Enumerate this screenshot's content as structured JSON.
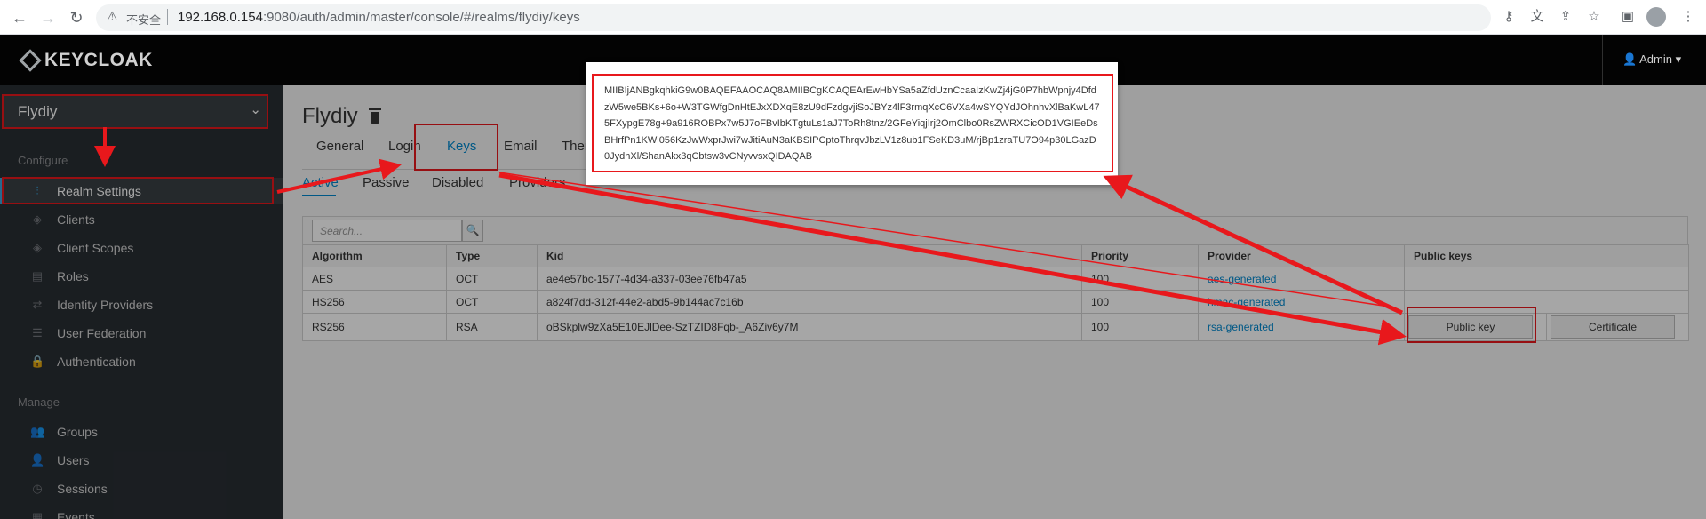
{
  "browser": {
    "insecure_label": "不安全",
    "url_host": "192.168.0.154",
    "url_path": ":9080/auth/admin/master/console/#/realms/flydiy/keys"
  },
  "header": {
    "logo_text": "KEYCLOAK",
    "user_label": "Admin"
  },
  "sidebar": {
    "realm": "Flydiy",
    "configure_label": "Configure",
    "configure_items": [
      {
        "label": "Realm Settings",
        "icon": "sliders-icon"
      },
      {
        "label": "Clients",
        "icon": "cube-icon"
      },
      {
        "label": "Client Scopes",
        "icon": "cubes-icon"
      },
      {
        "label": "Roles",
        "icon": "roles-icon"
      },
      {
        "label": "Identity Providers",
        "icon": "exchange-icon"
      },
      {
        "label": "User Federation",
        "icon": "database-icon"
      },
      {
        "label": "Authentication",
        "icon": "lock-icon"
      }
    ],
    "manage_label": "Manage",
    "manage_items": [
      {
        "label": "Groups",
        "icon": "users-icon"
      },
      {
        "label": "Users",
        "icon": "user-icon"
      },
      {
        "label": "Sessions",
        "icon": "clock-icon"
      },
      {
        "label": "Events",
        "icon": "calendar-icon"
      }
    ]
  },
  "main": {
    "title": "Flydiy",
    "tabs": [
      "General",
      "Login",
      "Keys",
      "Email",
      "Them"
    ],
    "subtabs": [
      "Active",
      "Passive",
      "Disabled",
      "Providers"
    ],
    "search_placeholder": "Search...",
    "table": {
      "headers": [
        "Algorithm",
        "Type",
        "Kid",
        "Priority",
        "Provider",
        "Public keys"
      ],
      "rows": [
        {
          "algorithm": "AES",
          "type": "OCT",
          "kid": "ae4e57bc-1577-4d34-a337-03ee76fb47a5",
          "priority": "100",
          "provider": "aes-generated"
        },
        {
          "algorithm": "HS256",
          "type": "OCT",
          "kid": "a824f7dd-312f-44e2-abd5-9b144ac7c16b",
          "priority": "100",
          "provider": "hmac-generated"
        },
        {
          "algorithm": "RS256",
          "type": "RSA",
          "kid": "oBSkplw9zXa5E10EJlDee-SzTZID8Fqb-_A6Ziv6y7M",
          "priority": "100",
          "provider": "rsa-generated",
          "public_key_btn": "Public key",
          "certificate_btn": "Certificate"
        }
      ]
    }
  },
  "popup": {
    "public_key": "MIIBIjANBgkqhkiG9w0BAQEFAAOCAQ8AMIIBCgKCAQEArEwHbYSa5aZfdUznCcaaIzKwZj4jG0P7hbWpnjy4DfdzW5we5BKs+6o+W3TGWfgDnHtEJxXDXqE8zU9dFzdgvjiSoJBYz4lF3rmqXcC6VXa4wSYQYdJOhnhvXlBaKwL475FXypgE78g+9a916ROBPx7w5J7oFBvIbKTgtuLs1aJ7ToRh8tnz/2GFeYiqjIrj2OmClbo0RsZWRXCicOD1VGIEeDsBHrfPn1KWi056KzJwWxprJwi7wJitiAuN3aKBSIPCptoThrqvJbzLV1z8ub1FSeKD3uM/rjBp1zraTU7O94p30LGazD0JydhXl/ShanAkx3qCbtsw3vCNyvvsxQIDAQAB"
  },
  "colors": {
    "annotation_red": "#e8181c",
    "link_blue": "#0088ce",
    "sidebar_bg": "#292e34"
  }
}
